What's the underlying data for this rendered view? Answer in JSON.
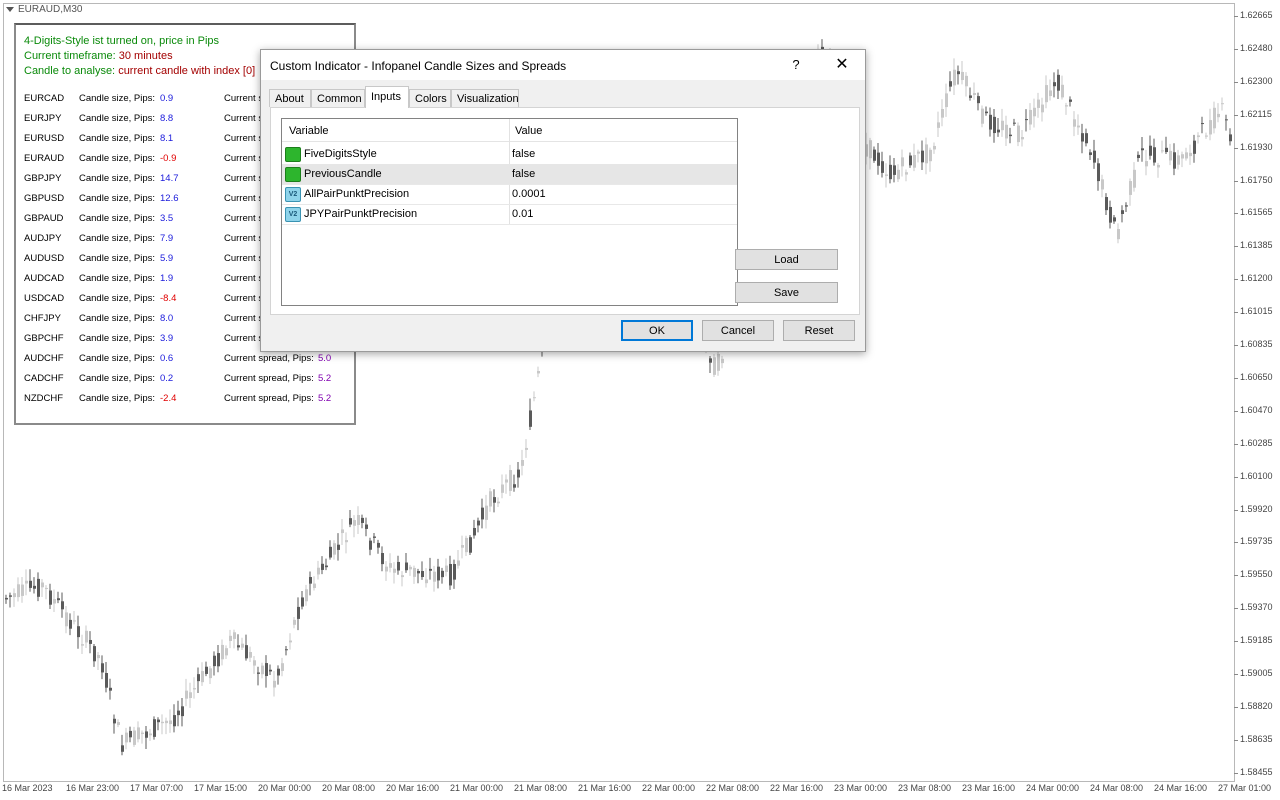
{
  "chart": {
    "symbol": "EURAUD,M30",
    "price_labels": [
      "1.62665",
      "1.62480",
      "1.62300",
      "1.62115",
      "1.61930",
      "1.61750",
      "1.61565",
      "1.61385",
      "1.61200",
      "1.61015",
      "1.60835",
      "1.60650",
      "1.60470",
      "1.60285",
      "1.60100",
      "1.59920",
      "1.59735",
      "1.59550",
      "1.59370",
      "1.59185",
      "1.59005",
      "1.58820",
      "1.58635",
      "1.58455"
    ],
    "time_labels": [
      "16 Mar 2023",
      "16 Mar 23:00",
      "17 Mar 07:00",
      "17 Mar 15:00",
      "20 Mar 00:00",
      "20 Mar 08:00",
      "20 Mar 16:00",
      "21 Mar 00:00",
      "21 Mar 08:00",
      "21 Mar 16:00",
      "22 Mar 00:00",
      "22 Mar 08:00",
      "22 Mar 16:00",
      "23 Mar 00:00",
      "23 Mar 08:00",
      "23 Mar 16:00",
      "24 Mar 00:00",
      "24 Mar 08:00",
      "24 Mar 16:00",
      "27 Mar 01:00"
    ],
    "bull_color": "#c8c8c8",
    "bear_color": "#5a5a5a"
  },
  "infopanel": {
    "line1": "4-Digits-Style ist turned on, price in Pips",
    "line2_label": "Current timeframe:",
    "line2_value": "30 minutes",
    "line3_label": "Candle to analyse:",
    "line3_value": "current candle with index [0]",
    "candle_label": "Candle size, Pips:",
    "spread_label": "Current spread, Pips:",
    "spread_label_cut": "Current s",
    "rows": [
      {
        "sym": "EURCAD",
        "cv": "0.9",
        "neg": false,
        "sv": ""
      },
      {
        "sym": "EURJPY",
        "cv": "8.8",
        "neg": false,
        "sv": ""
      },
      {
        "sym": "EURUSD",
        "cv": "8.1",
        "neg": false,
        "sv": ""
      },
      {
        "sym": "EURAUD",
        "cv": "-0.9",
        "neg": true,
        "sv": ""
      },
      {
        "sym": "GBPJPY",
        "cv": "14.7",
        "neg": false,
        "sv": ""
      },
      {
        "sym": "GBPUSD",
        "cv": "12.6",
        "neg": false,
        "sv": ""
      },
      {
        "sym": "GBPAUD",
        "cv": "3.5",
        "neg": false,
        "sv": ""
      },
      {
        "sym": "AUDJPY",
        "cv": "7.9",
        "neg": false,
        "sv": ""
      },
      {
        "sym": "AUDUSD",
        "cv": "5.9",
        "neg": false,
        "sv": ""
      },
      {
        "sym": "AUDCAD",
        "cv": "1.9",
        "neg": false,
        "sv": ""
      },
      {
        "sym": "USDCAD",
        "cv": "-8.4",
        "neg": true,
        "sv": ""
      },
      {
        "sym": "CHFJPY",
        "cv": "8.0",
        "neg": false,
        "sv": ""
      },
      {
        "sym": "GBPCHF",
        "cv": "3.9",
        "neg": false,
        "sv": ""
      },
      {
        "sym": "AUDCHF",
        "cv": "0.6",
        "neg": false,
        "sv": "5.0"
      },
      {
        "sym": "CADCHF",
        "cv": "0.2",
        "neg": false,
        "sv": "5.2"
      },
      {
        "sym": "NZDCHF",
        "cv": "-2.4",
        "neg": true,
        "sv": "5.2"
      }
    ]
  },
  "dialog": {
    "title": "Custom Indicator - Infopanel Candle Sizes and Spreads",
    "help": "?",
    "close": "✕",
    "tabs": [
      "About",
      "Common",
      "Inputs",
      "Colors",
      "Visualization"
    ],
    "active_tab": "Inputs",
    "col_variable": "Variable",
    "col_value": "Value",
    "params": [
      {
        "name": "FiveDigitsStyle",
        "value": "false",
        "type": "bool",
        "icon": "bool-param-icon"
      },
      {
        "name": "PreviousCandle",
        "value": "false",
        "type": "bool",
        "icon": "bool-param-icon",
        "selected": true
      },
      {
        "name": "AllPairPunktPrecision",
        "value": "0.0001",
        "type": "num",
        "icon": "double-param-icon"
      },
      {
        "name": "JPYPairPunktPrecision",
        "value": "0.01",
        "type": "num",
        "icon": "double-param-icon"
      }
    ],
    "load": "Load",
    "save": "Save",
    "ok": "OK",
    "cancel": "Cancel",
    "reset": "Reset"
  }
}
